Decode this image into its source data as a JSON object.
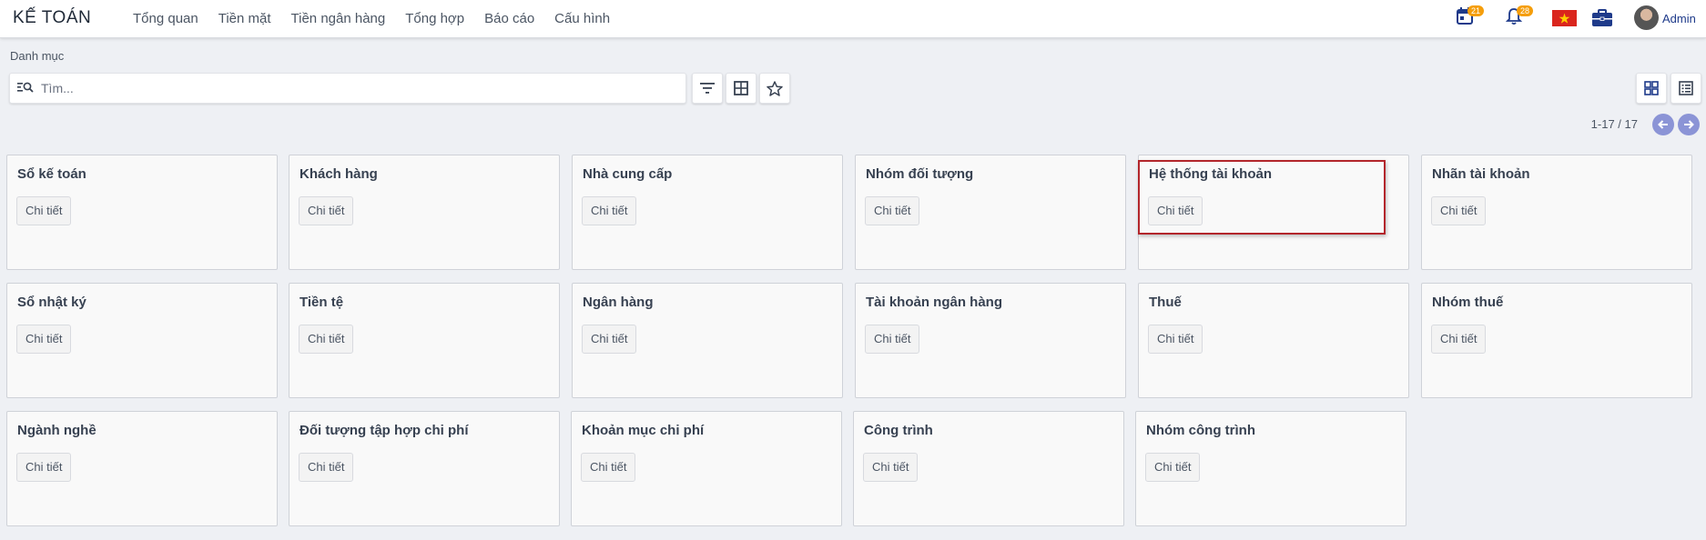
{
  "app": {
    "brand": "KẾ TOÁN",
    "menu": [
      "Tổng quan",
      "Tiền mặt",
      "Tiền ngân hàng",
      "Tổng hợp",
      "Báo cáo",
      "Cấu hình"
    ],
    "calendar_badge": "21",
    "bell_badge": "28",
    "user_name": "Admin"
  },
  "breadcrumb": "Danh mục",
  "search": {
    "placeholder": "Tìm..."
  },
  "pager": {
    "text": "1-17 / 17"
  },
  "cards": [
    {
      "title": "Sổ kế toán",
      "button": "Chi tiết"
    },
    {
      "title": "Khách hàng",
      "button": "Chi tiết"
    },
    {
      "title": "Nhà cung cấp",
      "button": "Chi tiết"
    },
    {
      "title": "Nhóm đối tượng",
      "button": "Chi tiết"
    },
    {
      "title": "Hệ thống tài khoản",
      "button": "Chi tiết"
    },
    {
      "title": "Nhãn tài khoản",
      "button": "Chi tiết"
    },
    {
      "title": "Sổ nhật ký",
      "button": "Chi tiết"
    },
    {
      "title": "Tiền tệ",
      "button": "Chi tiết"
    },
    {
      "title": "Ngân hàng",
      "button": "Chi tiết"
    },
    {
      "title": "Tài khoản ngân hàng",
      "button": "Chi tiết"
    },
    {
      "title": "Thuế",
      "button": "Chi tiết"
    },
    {
      "title": "Nhóm thuế",
      "button": "Chi tiết"
    },
    {
      "title": "Ngành nghề",
      "button": "Chi tiết"
    },
    {
      "title": "Đối tượng tập hợp chi phí",
      "button": "Chi tiết"
    },
    {
      "title": "Khoản mục chi phí",
      "button": "Chi tiết"
    },
    {
      "title": "Công trình",
      "button": "Chi tiết"
    },
    {
      "title": "Nhóm công trình",
      "button": "Chi tiết"
    }
  ],
  "colors": {
    "accent": "#8b94d6",
    "badge": "#f59e0b",
    "highlight": "#b3262b",
    "brand_text": "#1e3a8a"
  },
  "icons": [
    "calendar-icon",
    "bell-icon",
    "vietnam-flag-icon",
    "briefcase-icon",
    "search-icon",
    "filter-icon",
    "grid-icon",
    "star-icon",
    "kanban-view-icon",
    "list-view-icon",
    "arrow-left-icon",
    "arrow-right-icon"
  ]
}
